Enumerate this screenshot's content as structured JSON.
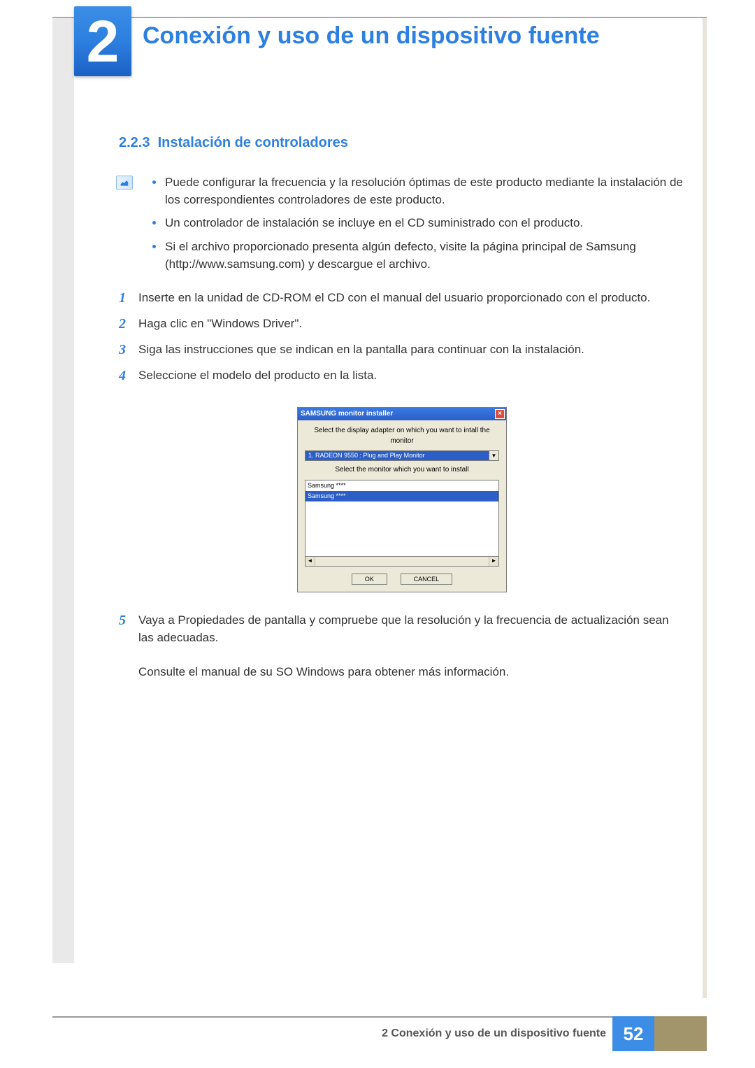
{
  "header": {
    "chapter_number": "2",
    "chapter_title": "Conexión y uso de un dispositivo fuente"
  },
  "section": {
    "number": "2.2.3",
    "title": "Instalación de controladores"
  },
  "notes": [
    "Puede configurar la frecuencia y la resolución óptimas de este producto mediante la instalación de los correspondientes controladores de este producto.",
    "Un controlador de instalación se incluye en el CD suministrado con el producto.",
    "Si el archivo proporcionado presenta algún defecto, visite la página principal de Samsung (http://www.samsung.com) y descargue el archivo."
  ],
  "steps": [
    {
      "num": "1",
      "text": "Inserte en la unidad de CD-ROM el CD con el manual del usuario proporcionado con el producto."
    },
    {
      "num": "2",
      "text": "Haga clic en \"Windows Driver\"."
    },
    {
      "num": "3",
      "text": "Siga las instrucciones que se indican en la pantalla para continuar con la instalación."
    },
    {
      "num": "4",
      "text": "Seleccione el modelo del producto en la lista."
    }
  ],
  "installer": {
    "title": "SAMSUNG monitor installer",
    "label_top": "Select the display adapter on which you want to intall the monitor",
    "combo_value": "1. RADEON 9550 : Plug and Play Monitor",
    "label_mid": "Select the monitor which you want to install",
    "list_items": [
      "Samsung ****",
      "Samsung ****"
    ],
    "btn_ok": "OK",
    "btn_cancel": "CANCEL"
  },
  "step5": {
    "num": "5",
    "text": "Vaya a Propiedades de pantalla y compruebe que la resolución y la frecuencia de actualización sean las adecuadas."
  },
  "step5_extra": "Consulte el manual de su SO Windows para obtener más información.",
  "footer": {
    "text": "2 Conexión y uso de un dispositivo fuente",
    "page": "52"
  }
}
